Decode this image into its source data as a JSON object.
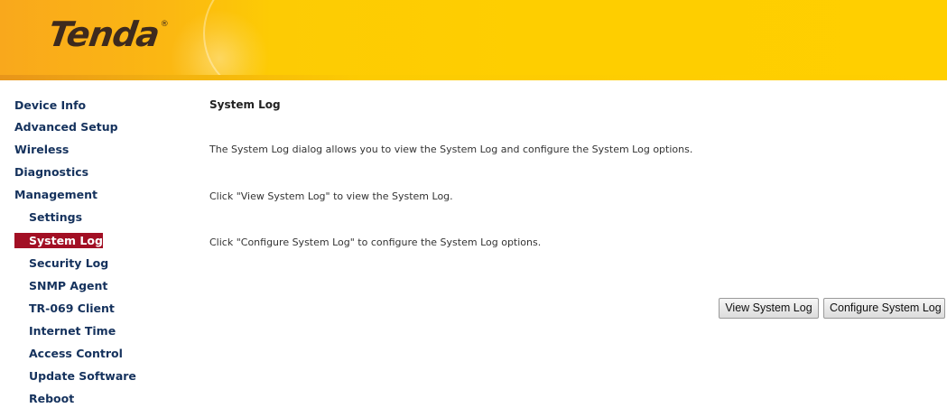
{
  "brand": {
    "logo_text": "Tenda",
    "logo_mark": "®",
    "colors": {
      "header_yellow": "#ffcf00",
      "header_orange": "#f9a81c",
      "logo_brown": "#3d2a1e",
      "nav_text": "#15325d",
      "nav_active_bg": "#a20f24",
      "nav_active_text": "#ffffff"
    }
  },
  "sidebar": {
    "items": [
      {
        "label": "Device Info",
        "level": "top",
        "active": false
      },
      {
        "label": "Advanced Setup",
        "level": "top",
        "active": false
      },
      {
        "label": "Wireless",
        "level": "top",
        "active": false
      },
      {
        "label": "Diagnostics",
        "level": "top",
        "active": false
      },
      {
        "label": "Management",
        "level": "top",
        "active": false
      },
      {
        "label": "Settings",
        "level": "sub",
        "active": false
      },
      {
        "label": "System Log",
        "level": "sub",
        "active": true
      },
      {
        "label": "Security Log",
        "level": "sub",
        "active": false
      },
      {
        "label": "SNMP Agent",
        "level": "sub",
        "active": false
      },
      {
        "label": "TR-069 Client",
        "level": "sub",
        "active": false
      },
      {
        "label": "Internet Time",
        "level": "sub",
        "active": false
      },
      {
        "label": "Access Control",
        "level": "sub",
        "active": false
      },
      {
        "label": "Update Software",
        "level": "sub",
        "active": false
      },
      {
        "label": "Reboot",
        "level": "sub",
        "active": false
      }
    ]
  },
  "main": {
    "title": "System Log",
    "paragraphs": [
      "The System Log dialog allows you to view the System Log and configure the System Log options.",
      "Click \"View System Log\" to view the System Log.",
      "Click \"Configure System Log\" to configure the System Log options."
    ],
    "buttons": {
      "view_label": "View System Log",
      "configure_label": "Configure System Log"
    }
  }
}
